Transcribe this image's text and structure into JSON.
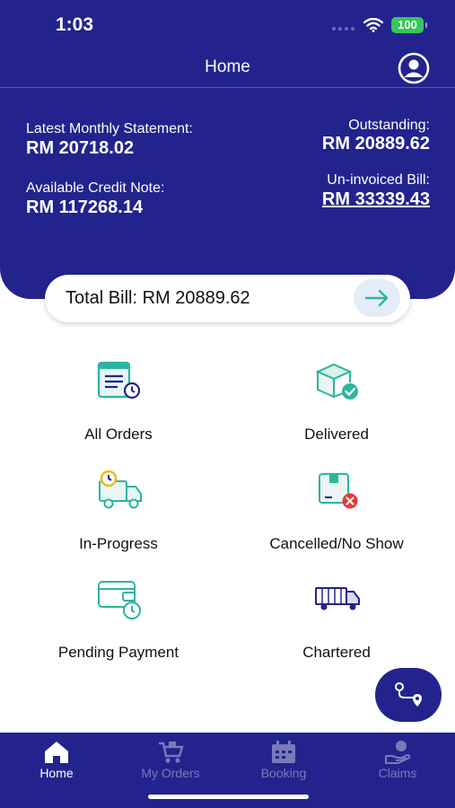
{
  "status_bar": {
    "time": "1:03",
    "battery": "100"
  },
  "nav": {
    "title": "Home"
  },
  "summary": {
    "latest_statement_label": "Latest Monthly Statement:",
    "latest_statement_value": "RM 20718.02",
    "credit_note_label": "Available Credit Note:",
    "credit_note_value": "RM 117268.14",
    "outstanding_label": "Outstanding:",
    "outstanding_value": "RM 20889.62",
    "uninvoiced_label": "Un-invoiced Bill:",
    "uninvoiced_value": "RM 33339.43"
  },
  "total_bill": {
    "label": "Total Bill: RM 20889.62"
  },
  "tiles": [
    {
      "label": "All Orders",
      "icon": "all-orders-icon"
    },
    {
      "label": "Delivered",
      "icon": "delivered-box-icon"
    },
    {
      "label": "In-Progress",
      "icon": "in-progress-truck-icon"
    },
    {
      "label": "Cancelled/No Show",
      "icon": "cancelled-box-icon"
    },
    {
      "label": "Pending Payment",
      "icon": "pending-payment-icon"
    },
    {
      "label": "Chartered",
      "icon": "chartered-truck-icon"
    }
  ],
  "tabs": [
    {
      "label": "Home",
      "icon": "home-icon",
      "active": true
    },
    {
      "label": "My Orders",
      "icon": "cart-icon",
      "active": false
    },
    {
      "label": "Booking",
      "icon": "calendar-icon",
      "active": false
    },
    {
      "label": "Claims",
      "icon": "claims-hand-icon",
      "active": false
    }
  ],
  "colors": {
    "primary": "#23238e",
    "accent": "#2bb5a0",
    "clock": "#f5b800",
    "danger": "#e53935"
  }
}
